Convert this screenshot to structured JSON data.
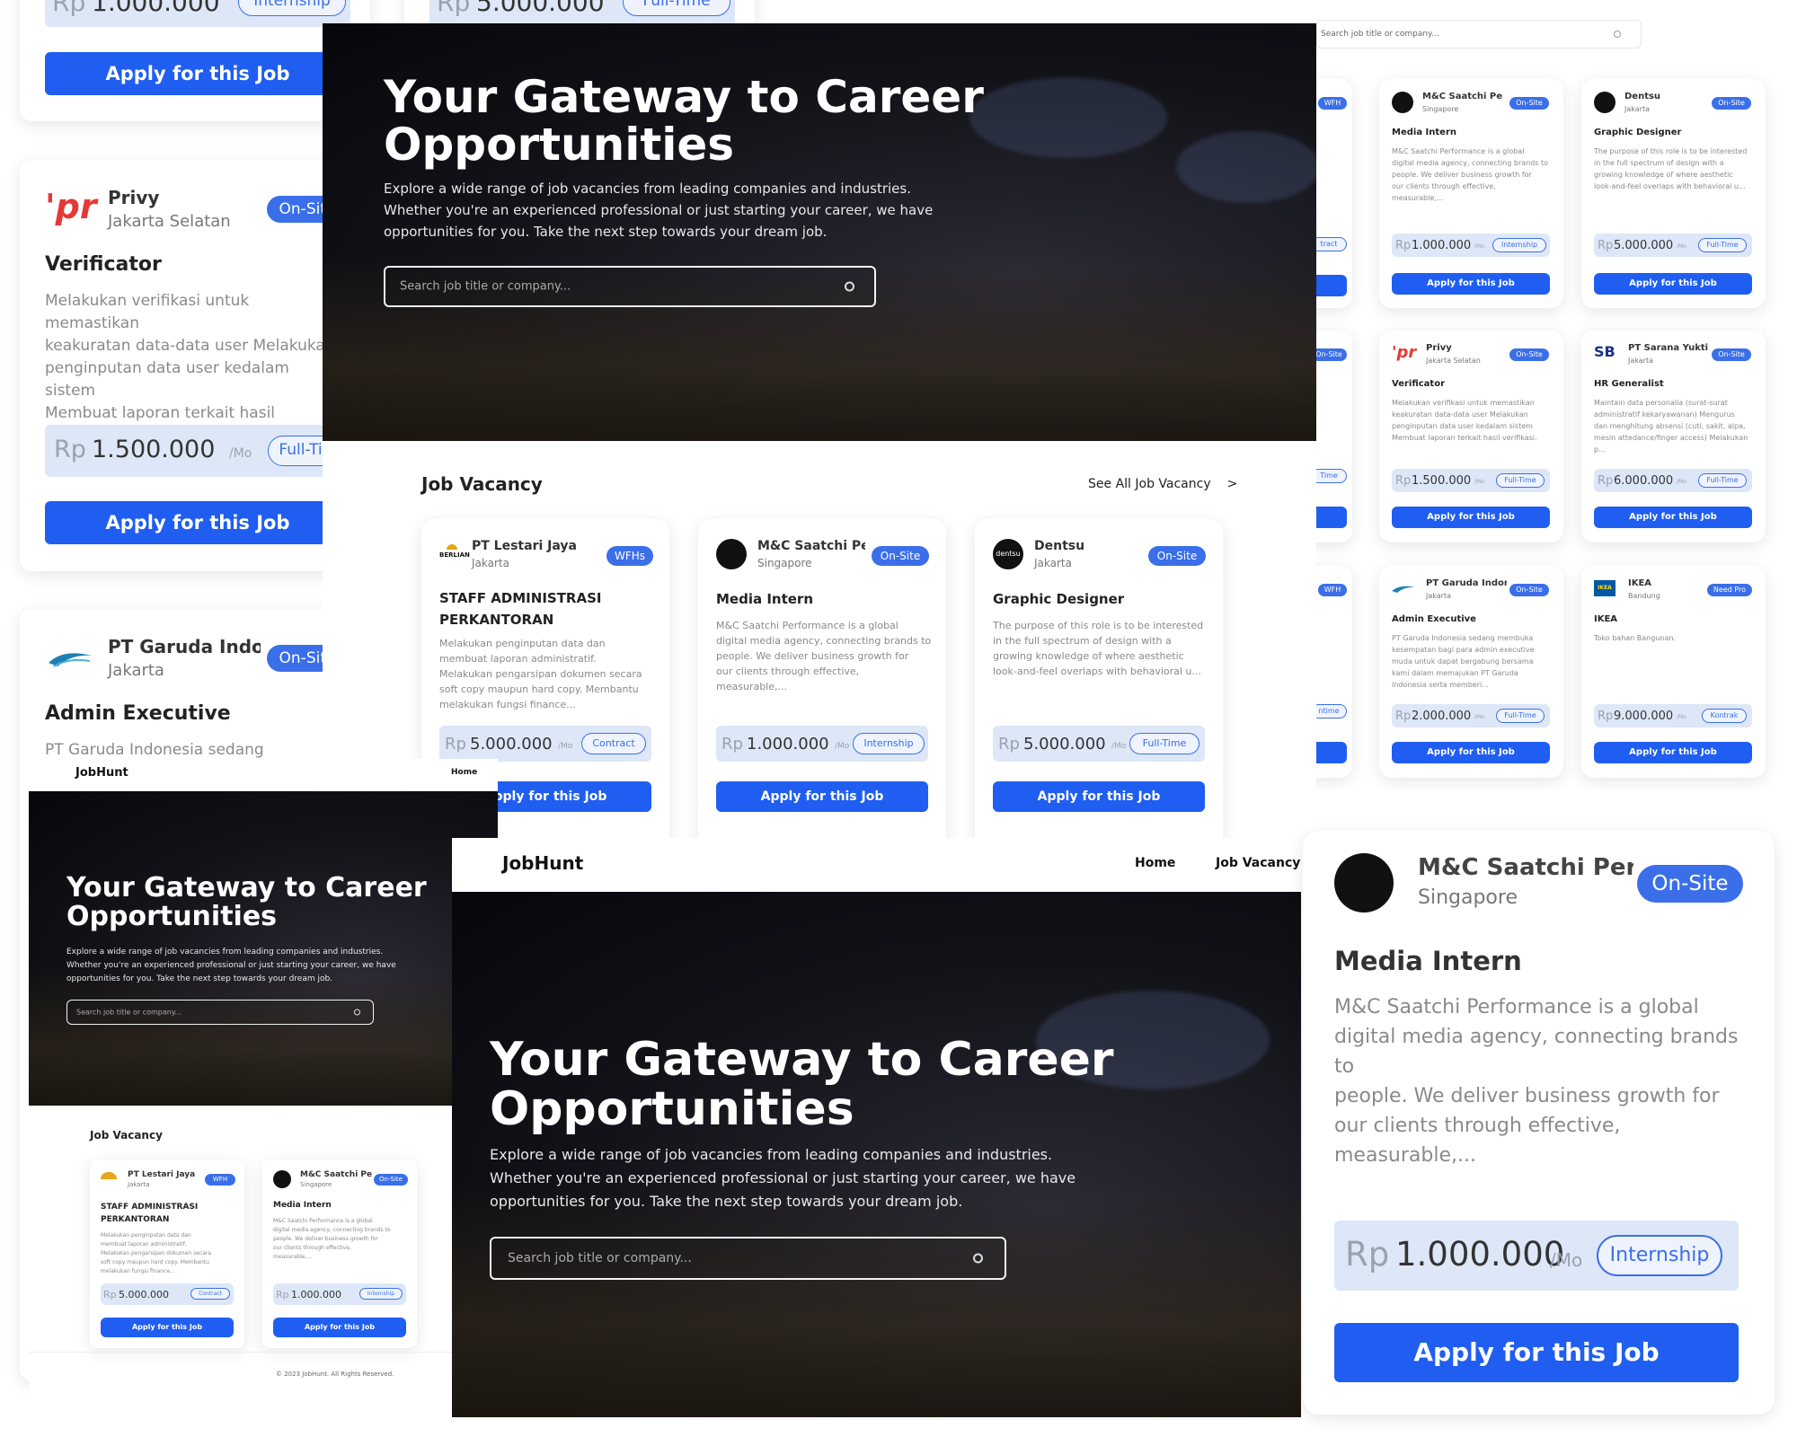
{
  "brand": "JobHunt",
  "nav": {
    "home": "Home",
    "vacancy": "Job Vacancy"
  },
  "hero": {
    "title_line1": "Your Gateway to Career",
    "title_line2": "Opportunities",
    "subtitle_1": "Explore a wide range of job vacancies from leading companies and industries.",
    "subtitle_2": "Whether you're an experienced professional or just starting your career, we have",
    "subtitle_3": "opportunities for you. Take the next step towards your dream job.",
    "search_placeholder": "Search job title or company..."
  },
  "section_title": "Job Vacancy",
  "see_all": "See All Job Vacancy",
  "see_all_arrow": ">",
  "apply_label": "Apply for this Job",
  "per_month": "/Mo",
  "currency": "Rp",
  "footer": "© 2023 JobHunt. All Rights Reserved.",
  "jobs": [
    {
      "company": "PT Lestari Jaya",
      "location": "Jakarta",
      "badge": "WFHs",
      "title_1": "STAFF ADMINISTRASI",
      "title_2": "PERKANTORAN",
      "desc": [
        "Melakukan penginputan data dan",
        "membuat laporan administratif.",
        "Melakukan pengarsipan dokumen secara",
        "soft copy maupun hard copy. Membantu",
        "melakukan fungsi finance..."
      ],
      "salary": "5.000.000",
      "type": "Contract"
    },
    {
      "company": "M&C Saatchi Per...",
      "location": "Singapore",
      "badge": "On-Site",
      "title_1": "Media Intern",
      "title_2": "",
      "desc": [
        "M&C Saatchi Performance is a global",
        "digital media agency, connecting brands to",
        "people. We deliver business growth for",
        "our clients through effective,",
        "measurable,..."
      ],
      "salary": "1.000.000",
      "type": "Internship"
    },
    {
      "company": "Dentsu",
      "location": "Jakarta",
      "badge": "On-Site",
      "title_1": "Graphic Designer",
      "title_2": "",
      "desc": [
        "The purpose of this role is to be interested",
        "in the full spectrum of design with a",
        "growing knowledge of where aesthetic",
        "look-and-feel overlaps with behavioral u..."
      ],
      "salary": "5.000.000",
      "type": "Full-Time"
    },
    {
      "company": "Privy",
      "location": "Jakarta Selatan",
      "badge": "On-Site",
      "title_1": "Verificator",
      "title_2": "",
      "desc": [
        "Melakukan verifikasi untuk memastikan",
        "keakuratan data-data user Melakukan",
        "penginputan data user kedalam sistem",
        "Membuat laporan terkait hasil verifikasi."
      ],
      "salary": "1.500.000",
      "type": "Full-Time"
    },
    {
      "company": "PT Sarana Yukti...",
      "location": "Jakarta",
      "badge": "On-Site",
      "title_1": "HR Generalist",
      "title_2": "",
      "desc": [
        "Maintain data personalia (surat-surat",
        "administratif kekaryawanan) Mengurus",
        "dan menghitung absensi (cuti, sakit, alpa,",
        "mesin attedance/finger access) Melakukan",
        "p..."
      ],
      "salary": "6.000.000",
      "type": "Full-Time"
    },
    {
      "company": "PT Garuda Indon...",
      "location": "Jakarta",
      "badge": "On-Site",
      "title_1": "Admin Executive",
      "title_2": "",
      "desc": [
        "PT Garuda Indonesia sedang membuka",
        "kesempatan bagi para admin executive",
        "muda untuk dapat bergabung bersama",
        "kami dalam memajukan PT Garuda",
        "Indonesia serta memberi..."
      ],
      "salary": "2.000.000",
      "type": "Full-Time"
    },
    {
      "company": "IKEA",
      "location": "Bandung",
      "badge": "Need Pro",
      "title_1": "IKEA",
      "title_2": "",
      "desc": [
        "Toko bahan Bangunan."
      ],
      "salary": "9.000.000",
      "type": "Kontrak"
    }
  ],
  "top_left_salaries": {
    "a": "1.000.000",
    "a_type": "Internship",
    "b": "5.000.000",
    "b_type": "Full-Time"
  },
  "partial_badges": {
    "wfh": "WFH",
    "contract": "tract",
    "time": "Time",
    "ntime": "ntime"
  },
  "logos": {
    "dentsu": "dentsu",
    "berijan": "BERLIAN",
    "garuda": "Garuda Indonesia",
    "privy": "'pr",
    "sarana": "SB",
    "ikea": "IKEA"
  }
}
